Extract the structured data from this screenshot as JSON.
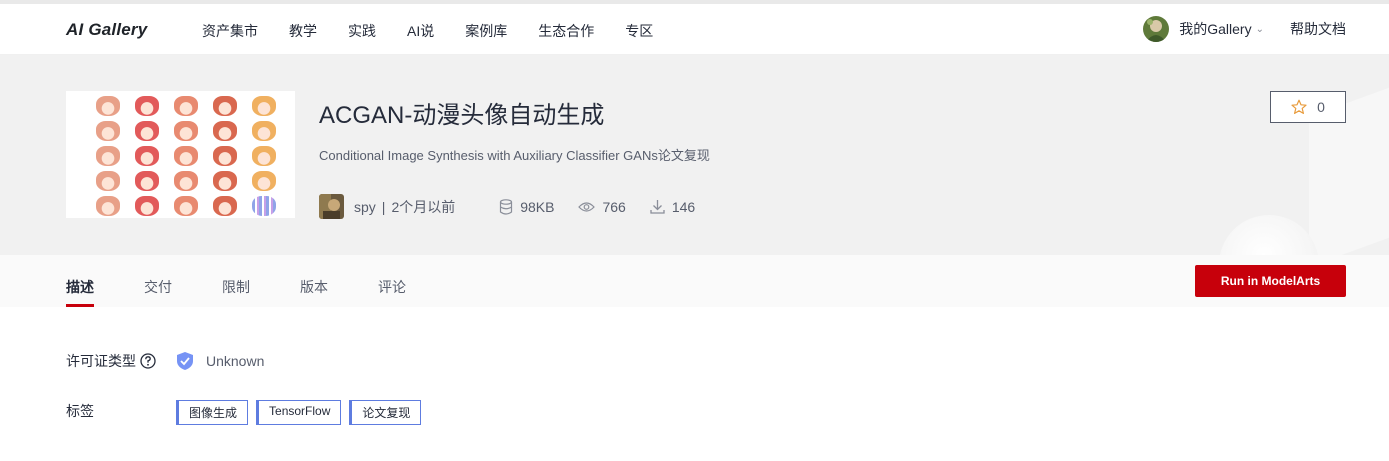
{
  "nav": {
    "logo": "AI Gallery",
    "items": [
      "资产集市",
      "教学",
      "实践",
      "AI说",
      "案例库",
      "生态合作",
      "专区"
    ],
    "my_gallery": "我的Gallery",
    "help": "帮助文档"
  },
  "asset": {
    "title": "ACGAN-动漫头像自动生成",
    "subtitle": "Conditional Image Synthesis with Auxiliary Classifier GANs论文复现",
    "author": "spy",
    "time": "2个月以前",
    "size": "98KB",
    "views": "766",
    "downloads": "146",
    "stars": "0"
  },
  "tabs": [
    "描述",
    "交付",
    "限制",
    "版本",
    "评论"
  ],
  "active_tab": "描述",
  "run_button": "Run in ModelArts",
  "details": {
    "license_label": "许可证类型",
    "license_value": "Unknown",
    "tags_label": "标签",
    "tags": [
      "图像生成",
      "TensorFlow",
      "论文复现"
    ]
  },
  "colors": {
    "brand_red": "#c7000b",
    "tag_border": "#5e7ce0",
    "shield": "#7693f5"
  }
}
